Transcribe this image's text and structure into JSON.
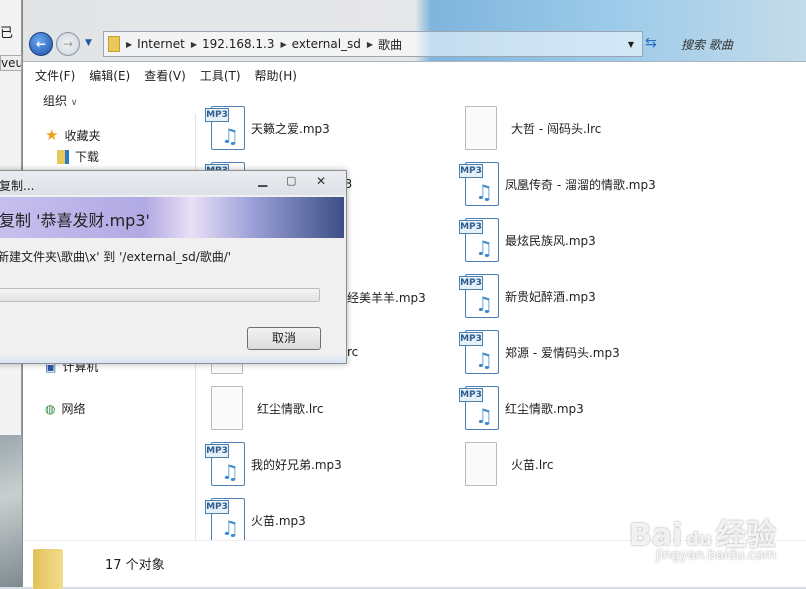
{
  "background": {
    "left_text_1": "已",
    "left_text_2": "veu"
  },
  "address": {
    "crumbs": [
      "Internet",
      "192.168.1.3",
      "external_sd",
      "歌曲"
    ],
    "search_placeholder": "搜索 歌曲"
  },
  "menu": [
    "文件(F)",
    "编辑(E)",
    "查看(V)",
    "工具(T)",
    "帮助(H)"
  ],
  "toolbar": {
    "organize": "组织"
  },
  "nav": {
    "favorites": "收藏夹",
    "downloads": "下载",
    "computer": "计算机",
    "network": "网络"
  },
  "files_left": [
    {
      "name": "天籁之爱.mp3",
      "type": "mp3"
    },
    {
      "name": "p3",
      "type": "mp3"
    },
    {
      "name": "经美羊羊.mp3",
      "type": "mp3"
    },
    {
      "name": "rc",
      "type": "lrc"
    },
    {
      "name": "红尘情歌.lrc",
      "type": "lrc"
    },
    {
      "name": "我的好兄弟.mp3",
      "type": "mp3"
    },
    {
      "name": "火苗.mp3",
      "type": "mp3"
    }
  ],
  "files_right": [
    {
      "name": "大哲 - 闯码头.lrc",
      "type": "lrc"
    },
    {
      "name": "凤凰传奇 - 溜溜的情歌.mp3",
      "type": "mp3"
    },
    {
      "name": "最炫民族风.mp3",
      "type": "mp3"
    },
    {
      "name": "新贵妃醉酒.mp3",
      "type": "mp3"
    },
    {
      "name": "郑源 - 爱情码头.mp3",
      "type": "mp3"
    },
    {
      "name": "红尘情歌.mp3",
      "type": "mp3"
    },
    {
      "name": "火苗.lrc",
      "type": "lrc"
    }
  ],
  "status": {
    "count": "17 个对象"
  },
  "dialog": {
    "title": "复制...",
    "heading": "复制 '恭喜发财.mp3'",
    "path": "新建文件夹\\歌曲\\x' 到 '/external_sd/歌曲/'",
    "progress": 0,
    "cancel": "取消"
  },
  "watermark": {
    "logo": "Baidu经验",
    "url": "jingyan.baidu.com"
  }
}
